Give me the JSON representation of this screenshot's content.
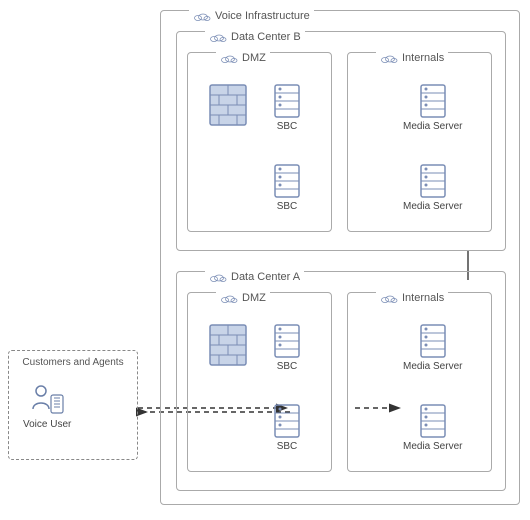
{
  "customers": {
    "label": "Customers and Agents",
    "voiceUser": "Voice User"
  },
  "voiceInfrastructure": {
    "label": "Voice Infrastructure",
    "dataCenterB": {
      "label": "Data Center B",
      "dmz": {
        "label": "DMZ",
        "sbc1": "SBC",
        "sbc2": "SBC"
      },
      "internals": {
        "label": "Internals",
        "mediaServer1": "Media Server",
        "mediaServer2": "Media Server"
      }
    },
    "dataCenterA": {
      "label": "Data Center A",
      "dmz": {
        "label": "DMZ",
        "sbc1": "SBC",
        "sbc2": "SBC"
      },
      "internals": {
        "label": "Internals",
        "mediaServer1": "Media Server",
        "mediaServer2": "Media Server"
      }
    }
  }
}
